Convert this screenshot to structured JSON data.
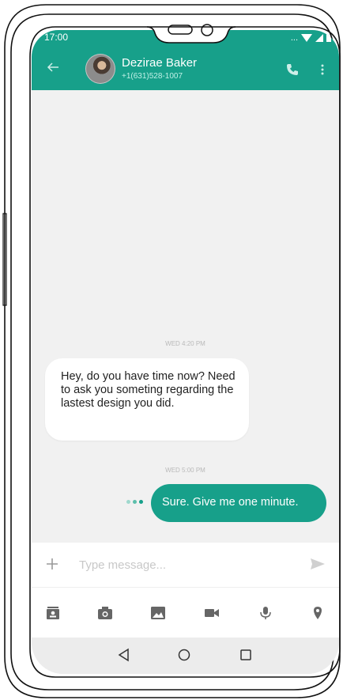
{
  "status_bar": {
    "time": "17:00",
    "signal_text": "..."
  },
  "header": {
    "contact_name": "Dezirae Baker",
    "contact_phone": "+1(631)528-1007",
    "accent_color": "#17a08a"
  },
  "conversation": {
    "messages": [
      {
        "timestamp": "WED 4:20 PM",
        "direction": "incoming",
        "text": "Hey, do you have time now? Need to ask you someting regarding the lastest design you did."
      },
      {
        "timestamp": "WED 5:00 PM",
        "direction": "outgoing",
        "text": "Sure. Give me one minute."
      }
    ]
  },
  "composer": {
    "placeholder": "Type message..."
  },
  "toolbar": {
    "icons": [
      "contact-card-icon",
      "camera-icon",
      "image-icon",
      "video-icon",
      "microphone-icon",
      "location-icon"
    ]
  },
  "nav": {
    "icons": [
      "back-triangle-icon",
      "home-circle-icon",
      "recents-square-icon"
    ]
  }
}
